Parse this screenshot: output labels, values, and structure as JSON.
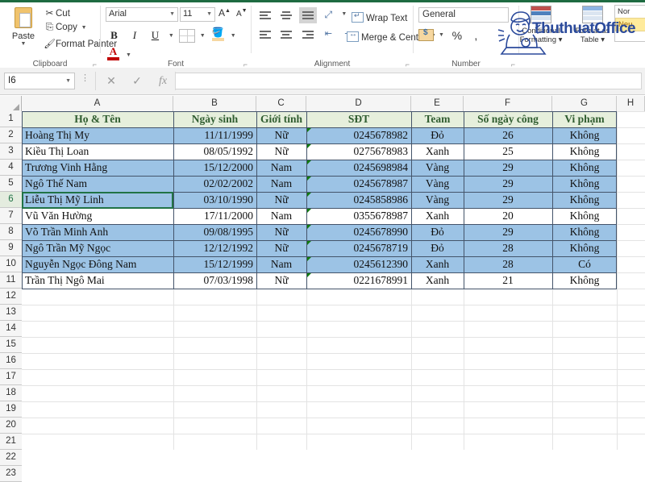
{
  "ribbon": {
    "clipboard": {
      "group_label": "Clipboard",
      "paste_label": "Paste",
      "items": [
        {
          "label": "Cut",
          "icon": "scissors-icon"
        },
        {
          "label": "Copy",
          "icon": "copy-icon"
        },
        {
          "label": "Format Painter",
          "icon": "paintbrush-icon"
        }
      ]
    },
    "font": {
      "group_label": "Font",
      "font_name": "Arial",
      "font_size": "11",
      "grow_label": "A",
      "shrink_label": "A",
      "bold_label": "B",
      "italic_label": "I",
      "underline_label": "U",
      "fill_label": "A",
      "font_color_label": "A"
    },
    "alignment": {
      "group_label": "Alignment",
      "wrap_text_label": "Wrap Text",
      "merge_center_label": "Merge & Center"
    },
    "number": {
      "group_label": "Number",
      "format_value": "General",
      "percent_label": "%",
      "comma_label": ","
    },
    "styles": {
      "conditional_formatting_label": "Conditional Formatting",
      "format_as_table_label": "Format as Table",
      "cell_style_normal": "Nor",
      "cell_style_neutral": "Neu"
    },
    "watermark": "ThuthuatOffice"
  },
  "formula_bar": {
    "name_box_value": "I6",
    "cancel_icon": "✕",
    "enter_icon": "✓",
    "function_icon": "fx",
    "formula_value": ""
  },
  "grid": {
    "column_headers": [
      "A",
      "B",
      "C",
      "D",
      "E",
      "F",
      "G",
      "H"
    ],
    "row_numbers": [
      1,
      2,
      3,
      4,
      5,
      6,
      7,
      8,
      9,
      10,
      11,
      12,
      13,
      14,
      15,
      16,
      17,
      18,
      19,
      20,
      21,
      22,
      23
    ],
    "active_row": 6,
    "table_headers": [
      "Họ & Tên",
      "Ngày sinh",
      "Giới tính",
      "SĐT",
      "Team",
      "Số ngày công",
      "Vi phạm"
    ],
    "rows": [
      {
        "row": 2,
        "selected": true,
        "name": "Hoàng Thị My",
        "dob": "11/11/1999",
        "gender": "Nữ",
        "phone": "0245678982",
        "team": "Đỏ",
        "days": "26",
        "violation": "Không"
      },
      {
        "row": 3,
        "selected": false,
        "name": "Kiều Thị Loan",
        "dob": "08/05/1992",
        "gender": "Nữ",
        "phone": "0275678983",
        "team": "Xanh",
        "days": "25",
        "violation": "Không"
      },
      {
        "row": 4,
        "selected": true,
        "name": "Trương Vinh Hằng",
        "dob": "15/12/2000",
        "gender": "Nam",
        "phone": "0245698984",
        "team": "Vàng",
        "days": "29",
        "violation": "Không"
      },
      {
        "row": 5,
        "selected": true,
        "name": "Ngô Thế Nam",
        "dob": "02/02/2002",
        "gender": "Nam",
        "phone": "0245678987",
        "team": "Vàng",
        "days": "29",
        "violation": "Không"
      },
      {
        "row": 6,
        "selected": true,
        "name": "Liễu Thị Mỹ Linh",
        "dob": "03/10/1990",
        "gender": "Nữ",
        "phone": "0245858986",
        "team": "Vàng",
        "days": "29",
        "violation": "Không"
      },
      {
        "row": 7,
        "selected": false,
        "name": "Vũ Văn Hường",
        "dob": "17/11/2000",
        "gender": "Nam",
        "phone": "0355678987",
        "team": "Xanh",
        "days": "20",
        "violation": "Không"
      },
      {
        "row": 8,
        "selected": true,
        "name": "Võ Trần Minh Anh",
        "dob": "09/08/1995",
        "gender": "Nữ",
        "phone": "0245678990",
        "team": "Đỏ",
        "days": "29",
        "violation": "Không"
      },
      {
        "row": 9,
        "selected": true,
        "name": "Ngô Trần Mỹ Ngọc",
        "dob": "12/12/1992",
        "gender": "Nữ",
        "phone": "0245678719",
        "team": "Đỏ",
        "days": "28",
        "violation": "Không"
      },
      {
        "row": 10,
        "selected": true,
        "name": "Nguyễn Ngọc Đông Nam",
        "dob": "15/12/1999",
        "gender": "Nam",
        "phone": "0245612390",
        "team": "Xanh",
        "days": "28",
        "violation": "Có"
      },
      {
        "row": 11,
        "selected": false,
        "name": "Trần Thị Ngô Mai",
        "dob": "07/03/1998",
        "gender": "Nữ",
        "phone": "0221678991",
        "team": "Xanh",
        "days": "21",
        "violation": "Không"
      }
    ]
  },
  "colors": {
    "header_fill": "#e6efdc",
    "header_text": "#2f5c2f",
    "selection_fill": "#9cc3e5",
    "table_border": "#44546a",
    "excel_green": "#217346",
    "error_triangle": "#107c10"
  }
}
